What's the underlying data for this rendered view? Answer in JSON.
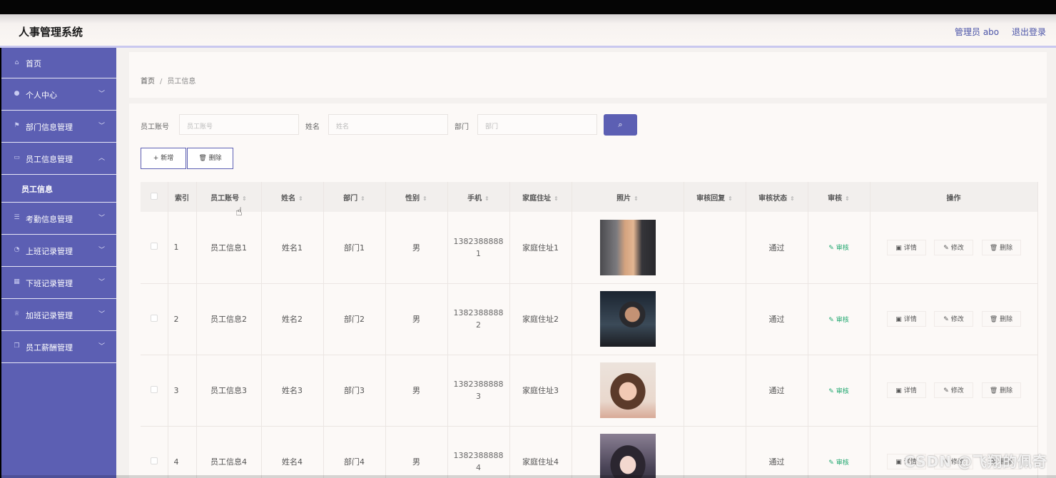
{
  "app": {
    "title": "人事管理系统"
  },
  "header": {
    "user": "管理员 abo",
    "logout": "退出登录"
  },
  "sidebar": {
    "items": [
      {
        "label": "首页",
        "icon": "home-icon"
      },
      {
        "label": "个人中心",
        "icon": "user-icon"
      },
      {
        "label": "部门信息管理",
        "icon": "flag-icon"
      },
      {
        "label": "员工信息管理",
        "icon": "id-card-icon",
        "expanded": true,
        "children": [
          "员工信息"
        ]
      },
      {
        "label": "考勤信息管理",
        "icon": "list-icon"
      },
      {
        "label": "上班记录管理",
        "icon": "clock-icon"
      },
      {
        "label": "下班记录管理",
        "icon": "grid-icon"
      },
      {
        "label": "加班记录管理",
        "icon": "trophy-icon"
      },
      {
        "label": "员工薪酬管理",
        "icon": "copy-icon"
      }
    ]
  },
  "breadcrumb": {
    "home": "首页",
    "sep": "/",
    "current": "员工信息"
  },
  "search": {
    "account_label": "员工账号",
    "account_placeholder": "员工账号",
    "name_label": "姓名",
    "name_placeholder": "姓名",
    "dept_label": "部门",
    "dept_placeholder": "部门",
    "search_icon": "search-icon"
  },
  "actions": {
    "add": "+ 新增",
    "delete": "🗑 删除"
  },
  "table": {
    "headers": [
      "索引",
      "员工账号",
      "姓名",
      "部门",
      "性别",
      "手机",
      "家庭住址",
      "照片",
      "审核回复",
      "审核状态",
      "审核",
      "操作"
    ],
    "rows": [
      {
        "index": "1",
        "account": "员工信息1",
        "name": "姓名1",
        "dept": "部门1",
        "gender": "男",
        "phone_a": "1382388888",
        "phone_b": "1",
        "address": "家庭住址1",
        "reply": "",
        "status": "通过"
      },
      {
        "index": "2",
        "account": "员工信息2",
        "name": "姓名2",
        "dept": "部门2",
        "gender": "男",
        "phone_a": "1382388888",
        "phone_b": "2",
        "address": "家庭住址2",
        "reply": "",
        "status": "通过"
      },
      {
        "index": "3",
        "account": "员工信息3",
        "name": "姓名3",
        "dept": "部门3",
        "gender": "男",
        "phone_a": "1382388888",
        "phone_b": "3",
        "address": "家庭住址3",
        "reply": "",
        "status": "通过"
      },
      {
        "index": "4",
        "account": "员工信息4",
        "name": "姓名4",
        "dept": "部门4",
        "gender": "男",
        "phone_a": "1382388888",
        "phone_b": "4",
        "address": "家庭住址4",
        "reply": "",
        "status": "通过"
      }
    ],
    "audit_label": "审核",
    "ops": {
      "detail": "详情",
      "edit": "修改",
      "delete": "删除"
    }
  },
  "watermark": "CSDN @飞翔的佩奇"
}
